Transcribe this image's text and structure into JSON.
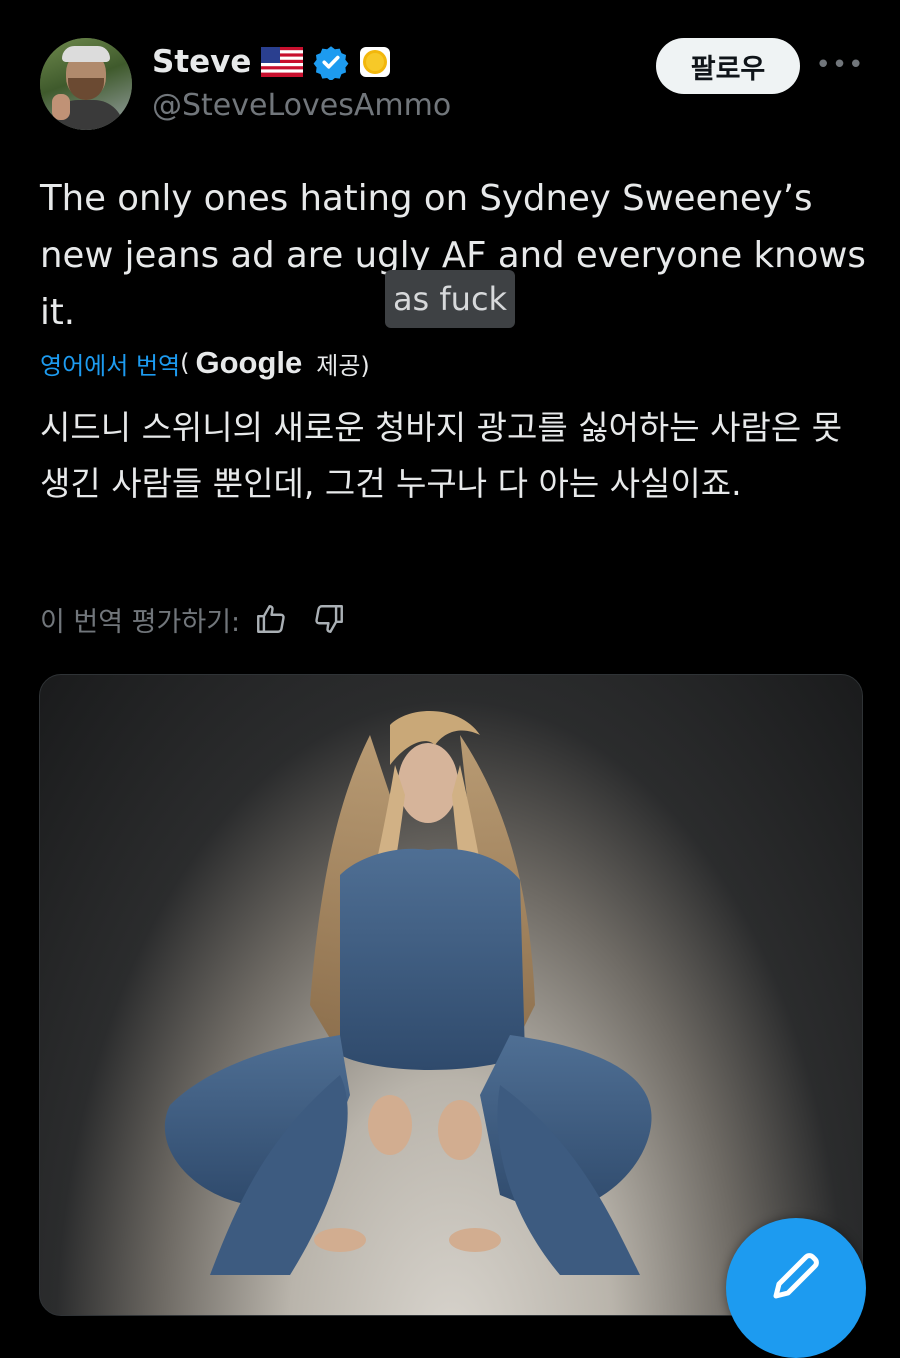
{
  "author": {
    "display_name": "Steve",
    "handle": "@SteveLovesAmmo",
    "flag_icon": "us-flag-icon",
    "verified_icon": "verified-badge-icon",
    "badge_icon": "gold-coin-icon",
    "accent_color": "#1d9bf0"
  },
  "actions": {
    "follow_label": "팔로우",
    "more_label": "•••"
  },
  "tweet": {
    "text": "The only ones hating on Sydney Sweeney’s new jeans ad are ugly AF and everyone knows it.",
    "tooltip": "as fuck"
  },
  "translation": {
    "link_label": "영어에서 번역",
    "open_paren": "(",
    "provider": "Google",
    "provided_label": "제공)",
    "text": "시드니 스위니의 새로운 청바지 광고를 싫어하는 사람은 못생긴 사람들 뿐인데, 그건 누구나 다 아는 사실이죠.",
    "rate_label": "이 번역 평가하기:"
  },
  "media": {
    "type": "photo"
  }
}
